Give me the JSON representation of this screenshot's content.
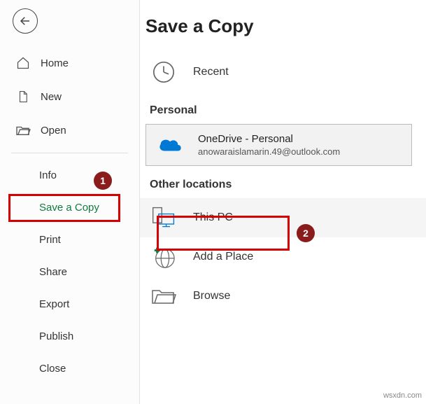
{
  "pageTitle": "Save a Copy",
  "sidebar": {
    "items": [
      {
        "label": "Home"
      },
      {
        "label": "New"
      },
      {
        "label": "Open"
      }
    ],
    "subItems": [
      {
        "label": "Info"
      },
      {
        "label": "Save a Copy",
        "selected": true
      },
      {
        "label": "Print"
      },
      {
        "label": "Share"
      },
      {
        "label": "Export"
      },
      {
        "label": "Publish"
      },
      {
        "label": "Close"
      }
    ]
  },
  "main": {
    "recent": "Recent",
    "personal": "Personal",
    "onedrive": {
      "title": "OneDrive - Personal",
      "subtitle": "anowaraislamarin.49@outlook.com"
    },
    "otherLocations": "Other locations",
    "thisPc": "This PC",
    "addPlace": "Add a Place",
    "browse": "Browse"
  },
  "annotations": {
    "badge1": "1",
    "badge2": "2"
  },
  "watermark": "wsxdn.com"
}
